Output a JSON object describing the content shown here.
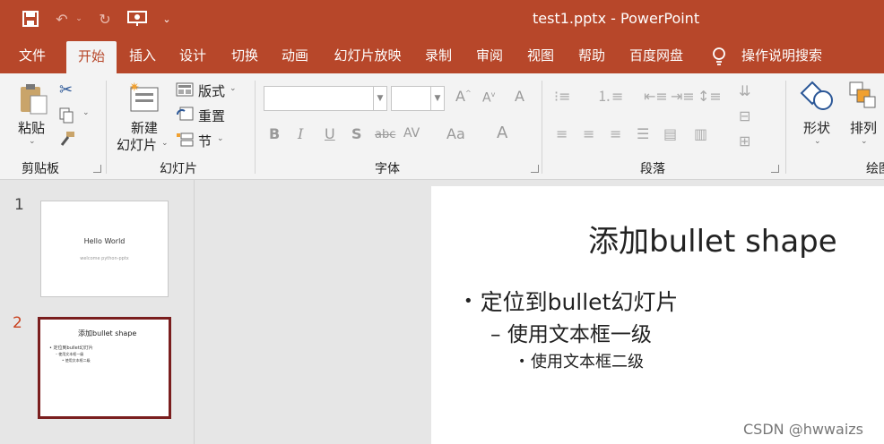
{
  "window": {
    "title": "test1.pptx  -  PowerPoint"
  },
  "tabs": [
    "文件",
    "开始",
    "插入",
    "设计",
    "切换",
    "动画",
    "幻灯片放映",
    "录制",
    "审阅",
    "视图",
    "帮助",
    "百度网盘"
  ],
  "search_label": "操作说明搜索",
  "ribbon": {
    "clipboard": {
      "paste": "粘贴",
      "label": "剪贴板"
    },
    "slides": {
      "new_slide_1": "新建",
      "new_slide_2": "幻灯片",
      "layout": "版式",
      "reset": "重置",
      "section": "节",
      "label": "幻灯片"
    },
    "font": {
      "label": "字体",
      "bold": "B",
      "italic": "I",
      "underline": "U",
      "shadow": "S",
      "strike": "abc",
      "spacing": "AV",
      "case": "Aa",
      "color": "A"
    },
    "paragraph": {
      "label": "段落"
    },
    "drawing": {
      "shapes": "形状",
      "arrange": "排列",
      "label": "绘图"
    }
  },
  "thumbnails": [
    {
      "number": "1",
      "title": "Hello World",
      "subtitle": "welcome python-pptx"
    },
    {
      "number": "2",
      "title": "添加bullet shape",
      "l1": "定位到bullet幻灯片",
      "l2": "– 使用文本框一级",
      "l3": "• 使用文本框二级"
    }
  ],
  "slide": {
    "title": "添加bullet shape",
    "bullet_1": "定位到bullet幻灯片",
    "bullet_2": "使用文本框一级",
    "bullet_3": "使用文本框二级"
  },
  "watermark": "CSDN @hwwaizs",
  "colors": {
    "accent": "#b7472a",
    "selected_thumb_border": "#7a1e1e"
  }
}
